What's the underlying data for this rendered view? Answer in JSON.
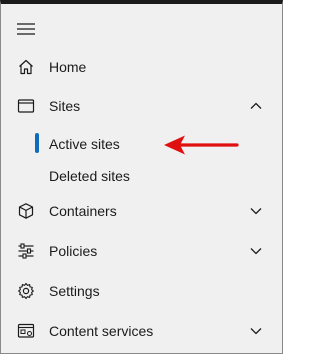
{
  "colors": {
    "panel_background": "#f0f0f0",
    "text": "#1b1b1b",
    "active_indicator": "#0f6cbd",
    "annotation_arrow": "#e01010"
  },
  "hamburger": {
    "icon": "hamburger-icon"
  },
  "nav": {
    "home": {
      "label": "Home",
      "icon": "home-icon"
    },
    "sites": {
      "label": "Sites",
      "icon": "browser-window-icon",
      "expanded": true,
      "children": [
        {
          "label": "Active sites",
          "active": true
        },
        {
          "label": "Deleted sites",
          "active": false
        }
      ]
    },
    "containers": {
      "label": "Containers",
      "icon": "cube-icon",
      "expanded": false
    },
    "policies": {
      "label": "Policies",
      "icon": "sliders-icon",
      "expanded": false
    },
    "settings": {
      "label": "Settings",
      "icon": "gear-icon"
    },
    "content_services": {
      "label": "Content services",
      "icon": "content-services-icon",
      "expanded": false
    }
  },
  "annotation": {
    "icon": "red-arrow-left-icon"
  }
}
